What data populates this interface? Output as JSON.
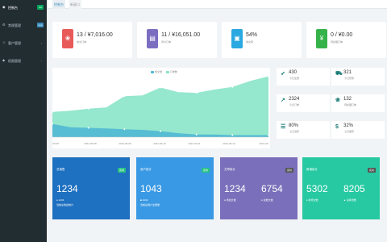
{
  "sidebar": {
    "items": [
      {
        "icon": "dashboard-icon",
        "label": "控制台",
        "badge": "hot",
        "badge_color": "#00a65a"
      },
      {
        "icon": "gear-icon",
        "label": "常规管理",
        "badge": "new",
        "badge_color": "#3c8dbc"
      },
      {
        "icon": "users-icon",
        "label": "客户管理"
      },
      {
        "icon": "shield-icon",
        "label": "权限管理"
      }
    ]
  },
  "tabs": [
    "控制台",
    "新窗口"
  ],
  "stats": [
    {
      "value": "13 / ¥7,016.00",
      "label": "成交订单",
      "color": "#e85a5a",
      "icon": "gift-icon"
    },
    {
      "value": "11 / ¥16,051.00",
      "label": "待付订单",
      "color": "#7b6ec1",
      "icon": "document-icon"
    },
    {
      "value": "54%",
      "label": "成交率",
      "color": "#29a9e0",
      "icon": "bag-icon"
    },
    {
      "value": "0 / ¥0.00",
      "label": "待处理订单",
      "color": "#35b34a",
      "icon": "yen-icon"
    }
  ],
  "chart_data": {
    "type": "area",
    "legend_position": "top",
    "grid": false,
    "x_ticks": [
      "03-08",
      "2021-09-08",
      "2021-09-09",
      "2021-09-10",
      "2021-09-11",
      "2021-09-12",
      "2021-09"
    ],
    "series": [
      {
        "name": "成交量",
        "color": "#4fb8d4",
        "values": [
          20,
          15,
          14,
          13,
          12,
          11,
          9,
          6,
          4,
          4,
          3,
          3,
          3
        ]
      },
      {
        "name": "订单数",
        "color": "#82e3c4",
        "values": [
          38,
          40,
          43,
          45,
          62,
          63,
          75,
          68,
          67,
          72,
          76,
          85,
          92
        ]
      }
    ],
    "ylim": [
      0,
      100
    ]
  },
  "mini_stats": [
    {
      "icon": "rocket-icon",
      "value": "430",
      "label": "今日注册"
    },
    {
      "icon": "cart-icon",
      "value": "321",
      "label": "今日登录"
    },
    {
      "icon": "trend-icon",
      "value": "2324",
      "label": "今日订单"
    },
    {
      "icon": "gift-icon",
      "value": "132",
      "label": "待处理订单"
    },
    {
      "icon": "list-icon",
      "value": "80%",
      "label": "七日活跃"
    },
    {
      "icon": "dollar-icon",
      "value": "32%",
      "label": "七日留存"
    }
  ],
  "cards": [
    {
      "title": "总销售",
      "badge": "实时",
      "badge_color": "#26c281",
      "value": "1234",
      "sub": "1234",
      "sub2": "当前总收益统计",
      "bg": "#1e70c0"
    },
    {
      "title": "用户统计",
      "badge": "实时",
      "badge_color": "#26c281",
      "value": "1043",
      "sub": "1043",
      "sub2": "当前总用户注册量",
      "bg": "#3a99e4"
    },
    {
      "title": "文章统计",
      "badge": "实时",
      "badge_color": "#555555",
      "value": "1234",
      "sub": "添加文章",
      "value2": "6754",
      "sub_b": "总数文章",
      "bg": "#7a6fba"
    },
    {
      "title": "新增统计",
      "badge": "实时",
      "badge_color": "#555555",
      "value": "5302",
      "sub": "新增次数",
      "value2": "8205",
      "sub_b": "总新增数",
      "bg": "#27c9a2"
    }
  ]
}
